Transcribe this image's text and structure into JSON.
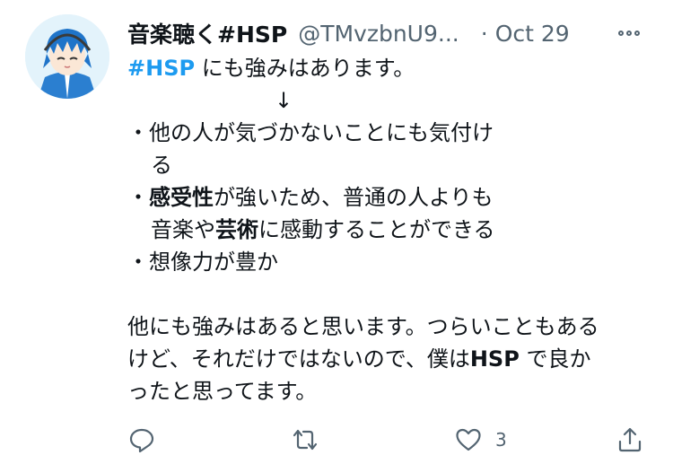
{
  "author": {
    "display_name": "音楽聴く#HSP",
    "handle": "@TMvzbnU9...",
    "separator": "·",
    "date": "Oct 29"
  },
  "tweet": {
    "hashtag": "#HSP",
    "line1_rest": " にも強みはあります。",
    "arrow": "↓",
    "item1_bullet": "・",
    "item1_text_a": "他の人が気づかないことにも気付け",
    "item1_text_b": "る",
    "item2_bullet": "・",
    "item2_bold1": "感受性",
    "item2_text_a": "が強いため、普通の人よりも",
    "item2_text_b1": "音楽や",
    "item2_bold2": "芸術",
    "item2_text_b2": "に感動することができる",
    "item3_bullet": "・",
    "item3_text": "想像力が豊か",
    "para2_line1": "他にも強みはあると思います。つらいこともある",
    "para2_line2_a": "けど、それだけではないので、僕は",
    "para2_line2_bold": "HSP",
    "para2_line2_b": " で良か",
    "para2_line3": "ったと思ってます。"
  },
  "actions": {
    "reply_icon": "reply-icon",
    "retweet_icon": "retweet-icon",
    "like_icon": "heart-icon",
    "like_count": "3",
    "share_icon": "share-icon"
  },
  "colors": {
    "hashtag": "#1d9bf0",
    "secondary_text": "#536471",
    "primary_text": "#0f1419"
  }
}
